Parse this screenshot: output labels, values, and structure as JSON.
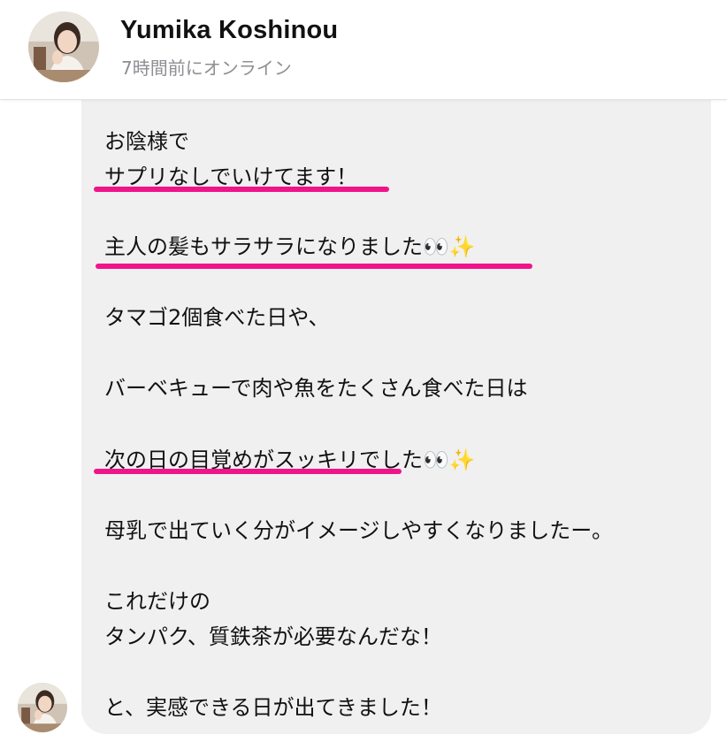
{
  "header": {
    "contact_name": "Yumika Koshinou",
    "status": "7時間前にオンライン"
  },
  "message": {
    "lines": [
      "お陰様で",
      "サプリなしでいけてます！",
      "主人の髪もサラサラになりました👀✨",
      "タマゴ2個食べた日や、",
      "バーベキューで肉や魚をたくさん食べた日は",
      "次の日の目覚めがスッキリでした👀✨",
      "母乳で出ていく分がイメージしやすくなりましたー。",
      "これだけの",
      "タンパク、質鉄茶が必要なんだな！",
      "と、実感できる日が出てきました！"
    ]
  },
  "colors": {
    "highlight_underline": "#f0148a",
    "bubble_background": "#f0f0f0",
    "status_text": "#8e8e93"
  }
}
